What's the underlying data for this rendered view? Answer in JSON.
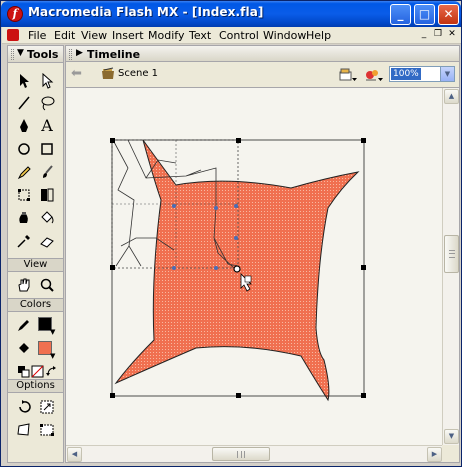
{
  "window": {
    "title": "Macromedia Flash MX - [Index.fla]",
    "app_icon_glyph": "f",
    "controls": {
      "minimize": "_",
      "maximize": "□",
      "close": "✕"
    }
  },
  "menubar": {
    "items": [
      "File",
      "Edit",
      "View",
      "Insert",
      "Modify",
      "Text",
      "Control",
      "Window",
      "Help"
    ],
    "doc_controls": {
      "minimize": "_",
      "restore": "❐",
      "close": "✕"
    }
  },
  "tools_panel": {
    "title": "Tools",
    "tools": [
      {
        "name": "arrow-tool",
        "icon": "arrow-icon"
      },
      {
        "name": "subselect-tool",
        "icon": "subselect-icon"
      },
      {
        "name": "line-tool",
        "icon": "line-icon"
      },
      {
        "name": "lasso-tool",
        "icon": "lasso-icon"
      },
      {
        "name": "pen-tool",
        "icon": "pen-icon"
      },
      {
        "name": "text-tool",
        "icon": "text-icon",
        "glyph": "A"
      },
      {
        "name": "oval-tool",
        "icon": "oval-icon"
      },
      {
        "name": "rectangle-tool",
        "icon": "rectangle-icon"
      },
      {
        "name": "pencil-tool",
        "icon": "pencil-icon"
      },
      {
        "name": "brush-tool",
        "icon": "brush-icon"
      },
      {
        "name": "free-transform-tool",
        "icon": "free-transform-icon"
      },
      {
        "name": "fill-transform-tool",
        "icon": "fill-transform-icon"
      },
      {
        "name": "ink-bottle-tool",
        "icon": "ink-bottle-icon"
      },
      {
        "name": "paint-bucket-tool",
        "icon": "paint-bucket-icon"
      },
      {
        "name": "eyedropper-tool",
        "icon": "eyedropper-icon"
      },
      {
        "name": "eraser-tool",
        "icon": "eraser-icon"
      }
    ],
    "view_label": "View",
    "colors_label": "Colors",
    "options_label": "Options",
    "stroke_color": "#000000",
    "fill_color": "#f07050"
  },
  "timeline": {
    "title": "Timeline"
  },
  "editbar": {
    "scene_label": "Scene 1",
    "zoom_value": "100%"
  },
  "stage": {
    "shape_fill": "#f07050",
    "background": "#f5f4ee"
  }
}
